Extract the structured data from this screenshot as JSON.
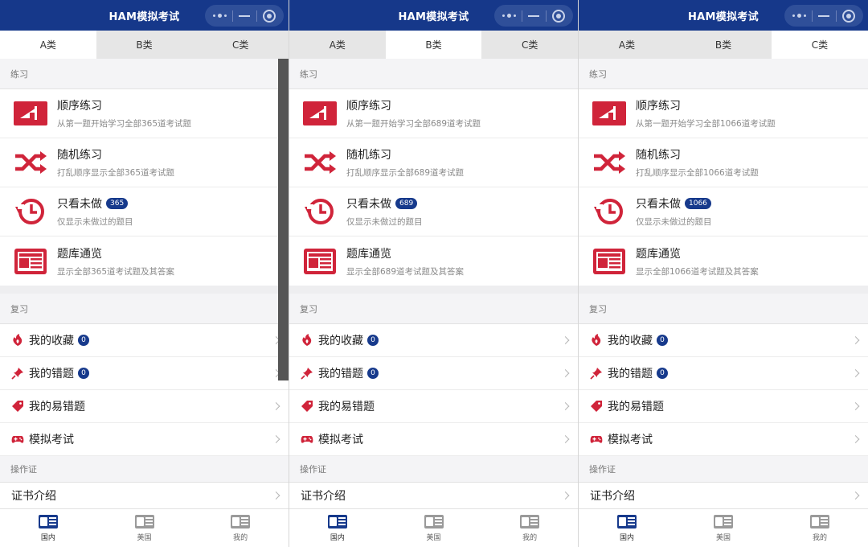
{
  "app_title": "HAM模拟考试",
  "tabs": [
    "A类",
    "B类",
    "C类"
  ],
  "section_practice": "练习",
  "section_review": "复习",
  "section_cert": "操作证",
  "practice_titles": {
    "seq": "顺序练习",
    "rand": "随机练习",
    "undone": "只看未做",
    "bank": "题库通览"
  },
  "review_labels": {
    "fav": "我的收藏",
    "wrong": "我的错题",
    "easy_wrong": "我的易错题",
    "mock": "模拟考试"
  },
  "cert_item": "证书介绍",
  "nav": [
    "国内",
    "美国",
    "我的"
  ],
  "colors": {
    "header": "#16388a",
    "accent_red": "#d0243a",
    "badge": "#173a8c"
  },
  "panels": [
    {
      "active_tab": 0,
      "seq_sub": "从第一题开始学习全部365道考试题",
      "rand_sub": "打乱顺序显示全部365道考试题",
      "undone_badge": "365",
      "undone_sub": "仅显示未做过的题目",
      "bank_sub": "显示全部365道考试题及其答案",
      "fav_count": "0",
      "wrong_count": "0",
      "show_scrollbar": true
    },
    {
      "active_tab": 1,
      "seq_sub": "从第一题开始学习全部689道考试题",
      "rand_sub": "打乱顺序显示全部689道考试题",
      "undone_badge": "689",
      "undone_sub": "仅显示未做过的题目",
      "bank_sub": "显示全部689道考试题及其答案",
      "fav_count": "0",
      "wrong_count": "0",
      "show_scrollbar": false
    },
    {
      "active_tab": 2,
      "seq_sub": "从第一题开始学习全部1066道考试题",
      "rand_sub": "打乱顺序显示全部1066道考试题",
      "undone_badge": "1066",
      "undone_sub": "仅显示未做过的题目",
      "bank_sub": "显示全部1066道考试题及其答案",
      "fav_count": "0",
      "wrong_count": "0",
      "show_scrollbar": false
    }
  ]
}
